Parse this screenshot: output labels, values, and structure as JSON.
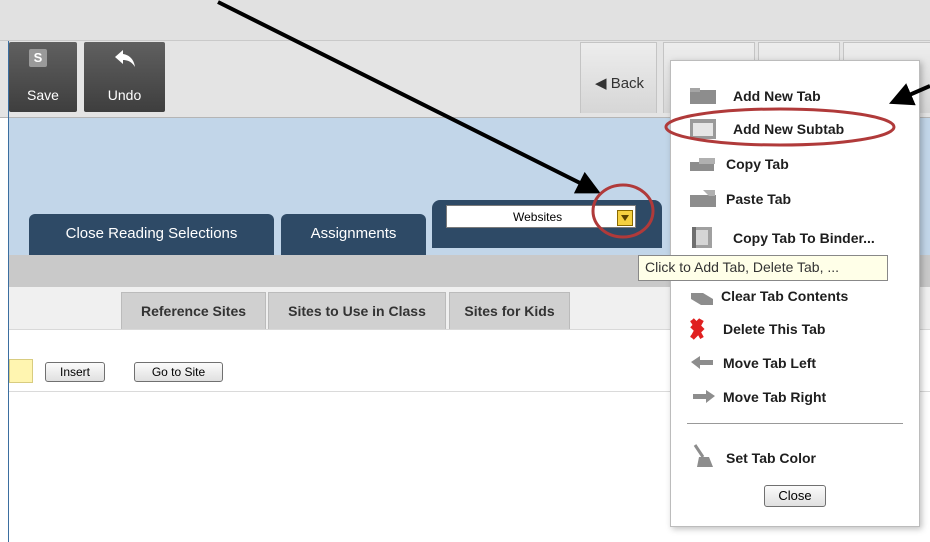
{
  "toolbar": {
    "save_label": "Save",
    "save_icon_letter": "S",
    "undo_label": "Undo",
    "back_label": "◀ Back"
  },
  "tabs": [
    {
      "label": "Close Reading Selections"
    },
    {
      "label": "Assignments"
    }
  ],
  "active_tab": {
    "select_value": "Websites"
  },
  "subtabs": [
    {
      "label": "Reference Sites"
    },
    {
      "label": "Sites to Use in Class"
    },
    {
      "label": "Sites for Kids"
    }
  ],
  "content": {
    "insert_label": "Insert",
    "goto_label": "Go to Site"
  },
  "tooltip": "Click to Add Tab, Delete Tab, ...",
  "menu": {
    "items": [
      {
        "label": "Add New Tab",
        "icon": "folder-icon"
      },
      {
        "label": "Add New Subtab",
        "icon": "subtab-icon"
      },
      {
        "label": "Copy Tab",
        "icon": "copy-icon"
      },
      {
        "label": "Paste Tab",
        "icon": "paste-icon"
      },
      {
        "label": "Copy Tab To Binder...",
        "icon": "binder-icon"
      },
      {
        "label": "Clear Tab Contents",
        "icon": "eraser-icon"
      },
      {
        "label": "Delete This Tab",
        "icon": "x-icon"
      },
      {
        "label": "Move Tab Left",
        "icon": "arrow-left-icon"
      },
      {
        "label": "Move Tab Right",
        "icon": "arrow-right-icon"
      },
      {
        "label": "Set Tab Color",
        "icon": "brush-icon"
      }
    ],
    "close_label": "Close"
  },
  "colors": {
    "tab_bg": "#2e4a66",
    "banner_bg": "#c2d6e9",
    "highlight_circle": "#b03a3a",
    "select_arrow": "#f5d040"
  }
}
